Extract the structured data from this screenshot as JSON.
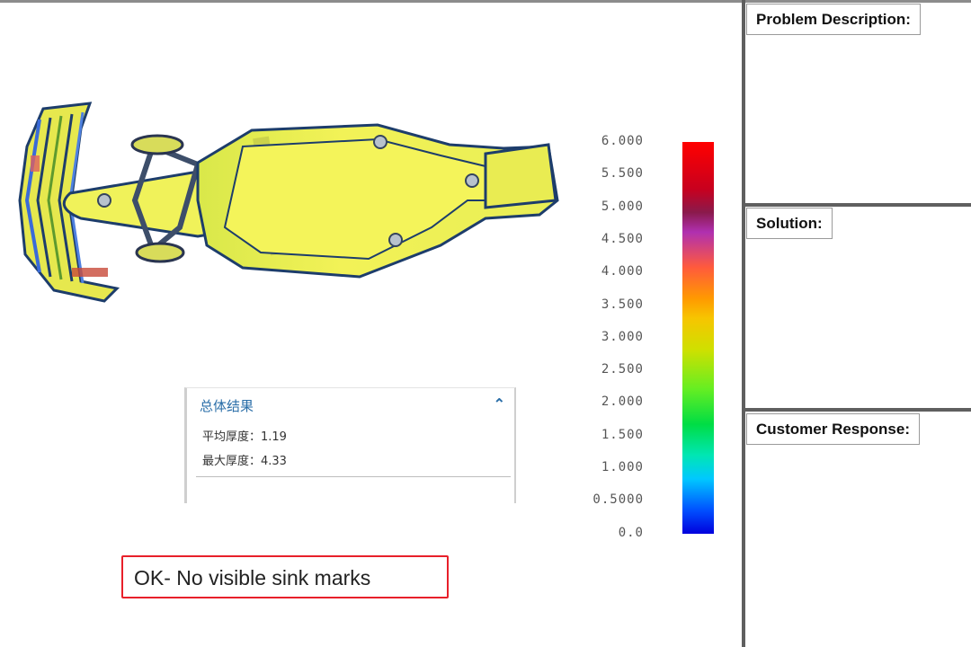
{
  "legend": {
    "ticks": [
      "6.000",
      "5.500",
      "5.000",
      "4.500",
      "4.000",
      "3.500",
      "3.000",
      "2.500",
      "2.000",
      "1.500",
      "1.000",
      "0.5000",
      "0.0"
    ],
    "color_top": "#ff0000",
    "color_bottom": "#0000dd"
  },
  "results": {
    "title": "总体结果",
    "collapse_icon": "chevron-up-icon",
    "average_thickness": "平均厚度：1.19",
    "max_thickness": "最大厚度：4.33"
  },
  "status_note": "OK- No visible sink marks",
  "side_panel": {
    "problem_description": "Problem Description:",
    "solution": "Solution:",
    "customer_response": "Customer Response:"
  }
}
